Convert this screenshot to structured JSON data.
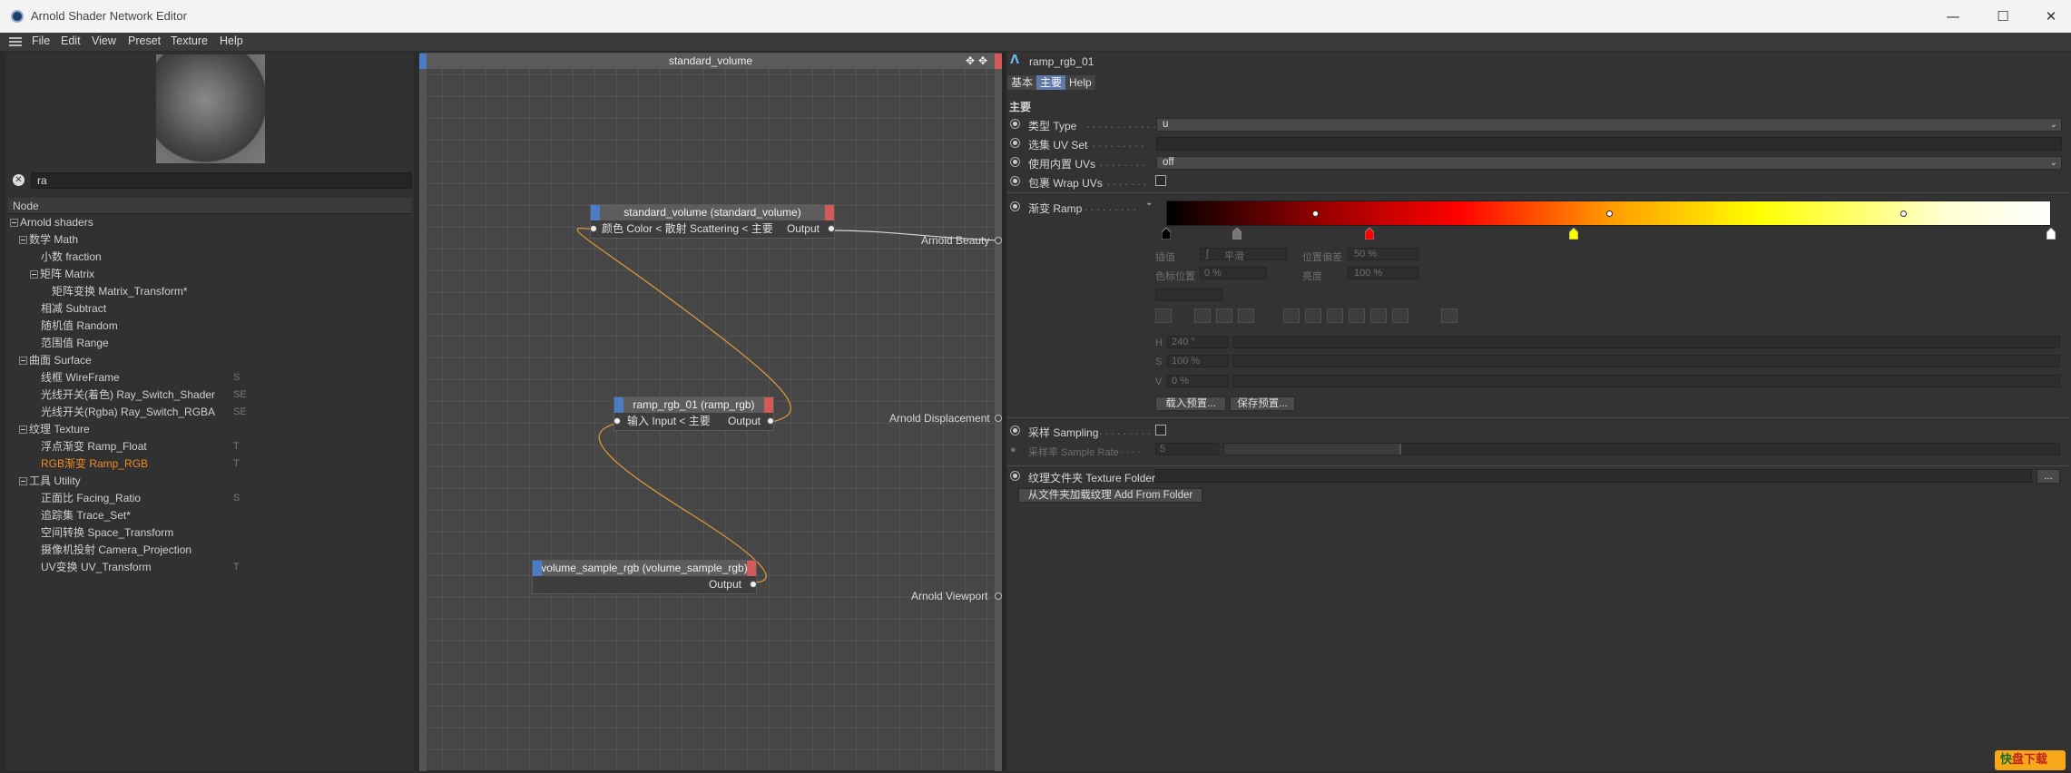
{
  "window": {
    "title": "Arnold Shader Network Editor",
    "minimize_glyph": "—",
    "maximize_glyph": "☐",
    "close_glyph": "✕"
  },
  "menubar": {
    "items": [
      "File",
      "Edit",
      "View",
      "Preset",
      "Texture",
      "Help"
    ]
  },
  "left_panel": {
    "search": {
      "value": "ra",
      "clear_glyph": "✕"
    },
    "tree_header": "Node",
    "tree": [
      {
        "label": "Arnold shaders",
        "shortcut": "",
        "level": 0,
        "expandable": true,
        "highlight": false
      },
      {
        "label": "数学 Math",
        "shortcut": "",
        "level": 1,
        "expandable": true,
        "highlight": false
      },
      {
        "label": "小数 fraction",
        "shortcut": "",
        "level": 2,
        "expandable": false,
        "highlight": false
      },
      {
        "label": "矩阵 Matrix",
        "shortcut": "",
        "level": 2,
        "expandable": true,
        "highlight": false
      },
      {
        "label": "矩阵变换 Matrix_Transform*",
        "shortcut": "",
        "level": 3,
        "expandable": false,
        "highlight": false
      },
      {
        "label": "相减 Subtract",
        "shortcut": "",
        "level": 2,
        "expandable": false,
        "highlight": false
      },
      {
        "label": "随机值 Random",
        "shortcut": "",
        "level": 2,
        "expandable": false,
        "highlight": false
      },
      {
        "label": "范围值 Range",
        "shortcut": "",
        "level": 2,
        "expandable": false,
        "highlight": false
      },
      {
        "label": "曲面 Surface",
        "shortcut": "",
        "level": 1,
        "expandable": true,
        "highlight": false
      },
      {
        "label": "线框 WireFrame",
        "shortcut": "S",
        "level": 2,
        "expandable": false,
        "highlight": false
      },
      {
        "label": "光线开关(着色) Ray_Switch_Shader",
        "shortcut": "SE",
        "level": 2,
        "expandable": false,
        "highlight": false
      },
      {
        "label": "光线开关(Rgba) Ray_Switch_RGBA",
        "shortcut": "SE",
        "level": 2,
        "expandable": false,
        "highlight": false
      },
      {
        "label": "纹理 Texture",
        "shortcut": "",
        "level": 1,
        "expandable": true,
        "highlight": false
      },
      {
        "label": "浮点渐变 Ramp_Float",
        "shortcut": "T",
        "level": 2,
        "expandable": false,
        "highlight": false
      },
      {
        "label": "RGB渐变 Ramp_RGB",
        "shortcut": "T",
        "level": 2,
        "expandable": false,
        "highlight": true
      },
      {
        "label": "工具 Utility",
        "shortcut": "",
        "level": 1,
        "expandable": true,
        "highlight": false
      },
      {
        "label": "正面比 Facing_Ratio",
        "shortcut": "S",
        "level": 2,
        "expandable": false,
        "highlight": false
      },
      {
        "label": "追踪集 Trace_Set*",
        "shortcut": "",
        "level": 2,
        "expandable": false,
        "highlight": false
      },
      {
        "label": "空间转换 Space_Transform",
        "shortcut": "",
        "level": 2,
        "expandable": false,
        "highlight": false
      },
      {
        "label": "摄像机投射 Camera_Projection",
        "shortcut": "",
        "level": 2,
        "expandable": false,
        "highlight": false
      },
      {
        "label": "UV变换 UV_Transform",
        "shortcut": "T",
        "level": 2,
        "expandable": false,
        "highlight": false
      }
    ]
  },
  "graph": {
    "title": "standard_volume",
    "nodes": {
      "standard_volume": {
        "title": "standard_volume (standard_volume)",
        "input": "颜色 Color < 散射 Scattering < 主要",
        "output": "Output"
      },
      "ramp": {
        "title": "ramp_rgb_01 (ramp_rgb)",
        "input": "输入 Input < 主要",
        "output": "Output"
      },
      "volume_sample": {
        "title": "volume_sample_rgb (volume_sample_rgb)",
        "output": "Output"
      }
    },
    "outputs": [
      "Arnold Beauty",
      "Arnold Displacement",
      "Arnold Viewport"
    ],
    "wire_color": "#d6953a"
  },
  "right_panel": {
    "node_name": "ramp_rgb_01",
    "tabs": [
      "基本",
      "主要",
      "Help"
    ],
    "active_tab": 1,
    "section": "主要",
    "type": {
      "label": "类型 Type",
      "dots": ". . . . . . . . . . . .",
      "value": "u"
    },
    "uv_set": {
      "label": "选集 UV Set",
      "dots": ". . . . . . . . . ."
    },
    "use_uvs": {
      "label": "使用内置 UVs",
      "dots": ". . . . . . . . .",
      "value": "off"
    },
    "wrap_uvs": {
      "label": "包裹 Wrap UVs",
      "dots": ". . . . . . . ."
    },
    "ramp": {
      "label": "渐变 Ramp",
      "dots": ". . . . . . . . .",
      "colors": [
        "#000000",
        "#9a0000",
        "#ff0000",
        "#ff9900",
        "#ffff00",
        "#ffffd0",
        "#ffffff"
      ],
      "knot_colors": [
        "#000000",
        "#777777",
        "#ff0000",
        "#ffff00",
        "#ffffff"
      ],
      "interp_label": "插值",
      "interp_value": "平滑",
      "bias_label": "位置偏差",
      "bias_value": "50 %",
      "pos_label": "色标位置",
      "pos_value": "0 %",
      "bright_label": "亮度",
      "bright_value": "100 %",
      "h_label": "H",
      "h_value": "240 °",
      "s_label": "S",
      "s_value": "100 %",
      "v_label": "V",
      "v_value": "0 %",
      "load_preset": "载入预置...",
      "save_preset": "保存预置..."
    },
    "sampling": {
      "label": "采样 Sampling",
      "dots": ". . . . . . . . ."
    },
    "sample_rate": {
      "label": "采样率 Sample Rate",
      "dots": ". . . .",
      "value": "5"
    },
    "texture_folder": {
      "label": "纹理文件夹 Texture Folder",
      "browse": "..."
    },
    "add_from_folder": "从文件夹加载纹理 Add From Folder"
  },
  "watermark": {
    "brand_a": "快",
    "brand_b": "盘下载"
  }
}
